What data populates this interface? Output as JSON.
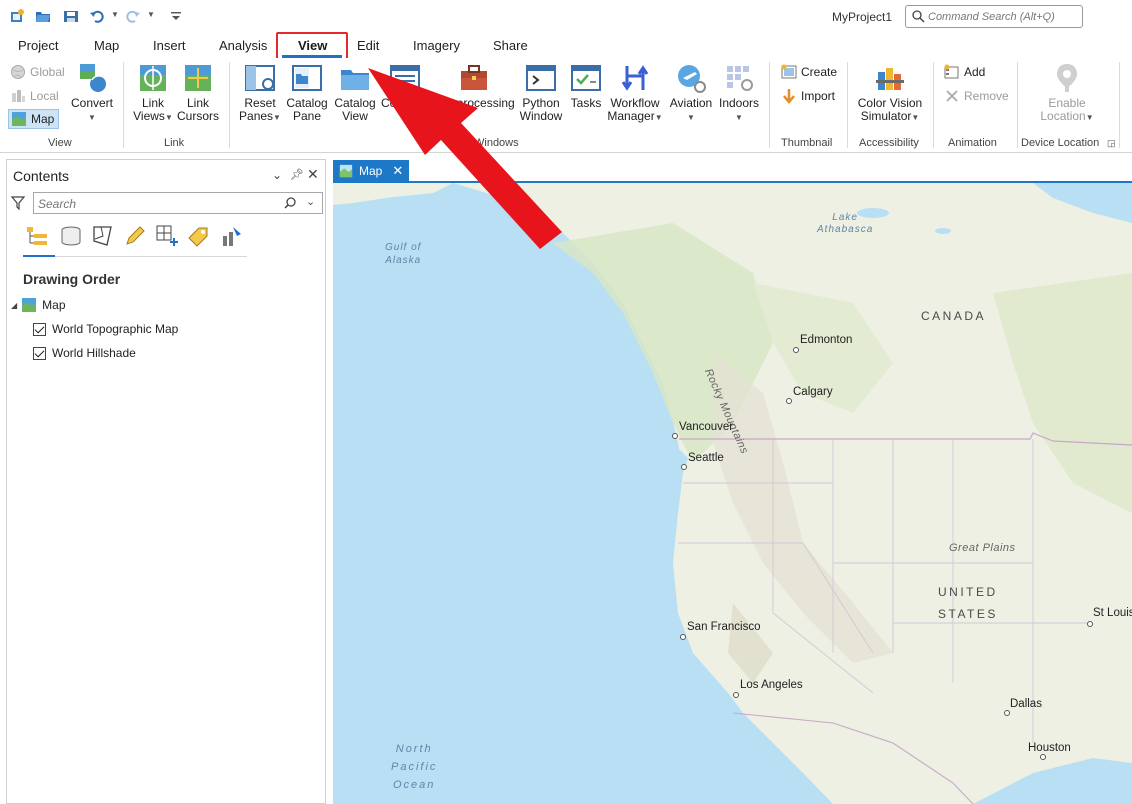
{
  "app": {
    "project_title": "MyProject1",
    "command_search_placeholder": "Command Search (Alt+Q)"
  },
  "quick_access": [
    "new-project-icon",
    "open-project-icon",
    "save-project-icon",
    "undo-icon",
    "redo-icon",
    "customize-icon"
  ],
  "ribbon_tabs": [
    {
      "label": "Project",
      "active": false
    },
    {
      "label": "Map",
      "active": false
    },
    {
      "label": "Insert",
      "active": false
    },
    {
      "label": "Analysis",
      "active": false
    },
    {
      "label": "View",
      "active": true
    },
    {
      "label": "Edit",
      "active": false
    },
    {
      "label": "Imagery",
      "active": false
    },
    {
      "label": "Share",
      "active": false
    }
  ],
  "ribbon": {
    "view_group": {
      "label": "View",
      "global": "Global",
      "local": "Local",
      "map": "Map",
      "convert": "Convert"
    },
    "link_group": {
      "label": "Link",
      "link_views": "Link Views",
      "link_cursors": "Link Cursors"
    },
    "windows_group": {
      "label": "Windows",
      "reset_panes": "Reset Panes",
      "catalog_pane": "Catalog Pane",
      "catalog_view": "Catalog View",
      "contents": "Contents",
      "geoprocessing": "Geoprocessing",
      "python_window": "Python Window",
      "tasks": "Tasks",
      "workflow_manager": "Workflow Manager",
      "aviation": "Aviation",
      "indoors": "Indoors"
    },
    "thumbnail_group": {
      "label": "Thumbnail",
      "create": "Create",
      "import": "Import"
    },
    "accessibility_group": {
      "label": "Accessibility",
      "color_vision": "Color Vision Simulator"
    },
    "animation_group": {
      "label": "Animation",
      "add": "Add",
      "remove": "Remove"
    },
    "device_location_group": {
      "label": "Device Location",
      "enable_location": "Enable Location"
    }
  },
  "contents_pane": {
    "title": "Contents",
    "search_placeholder": "Search",
    "section_title": "Drawing Order",
    "map_name": "Map",
    "layers": [
      {
        "name": "World Topographic Map",
        "checked": true
      },
      {
        "name": "World Hillshade",
        "checked": true
      }
    ]
  },
  "map_view": {
    "tab_label": "Map",
    "labels": {
      "gulf_of_alaska_1": "Gulf of",
      "gulf_of_alaska_2": "Alaska",
      "lake_athabasca_1": "Lake",
      "lake_athabasca_2": "Athabasca",
      "canada": "CANADA",
      "united": "UNITED",
      "states": "STATES",
      "rocky": "Rocky Mountains",
      "great_plains": "Great Plains",
      "north": "North",
      "pacific": "Pacific",
      "ocean": "Ocean"
    },
    "cities": {
      "edmonton": "Edmonton",
      "calgary": "Calgary",
      "vancouver": "Vancouver",
      "seattle": "Seattle",
      "san_francisco": "San Francisco",
      "los_angeles": "Los Angeles",
      "dallas": "Dallas",
      "houston": "Houston",
      "st_louis": "St Louis"
    }
  },
  "colors": {
    "accent": "#1f72c8",
    "highlight_red": "#e4282c",
    "water": "#b9dff4",
    "land": "#eeefe4"
  }
}
